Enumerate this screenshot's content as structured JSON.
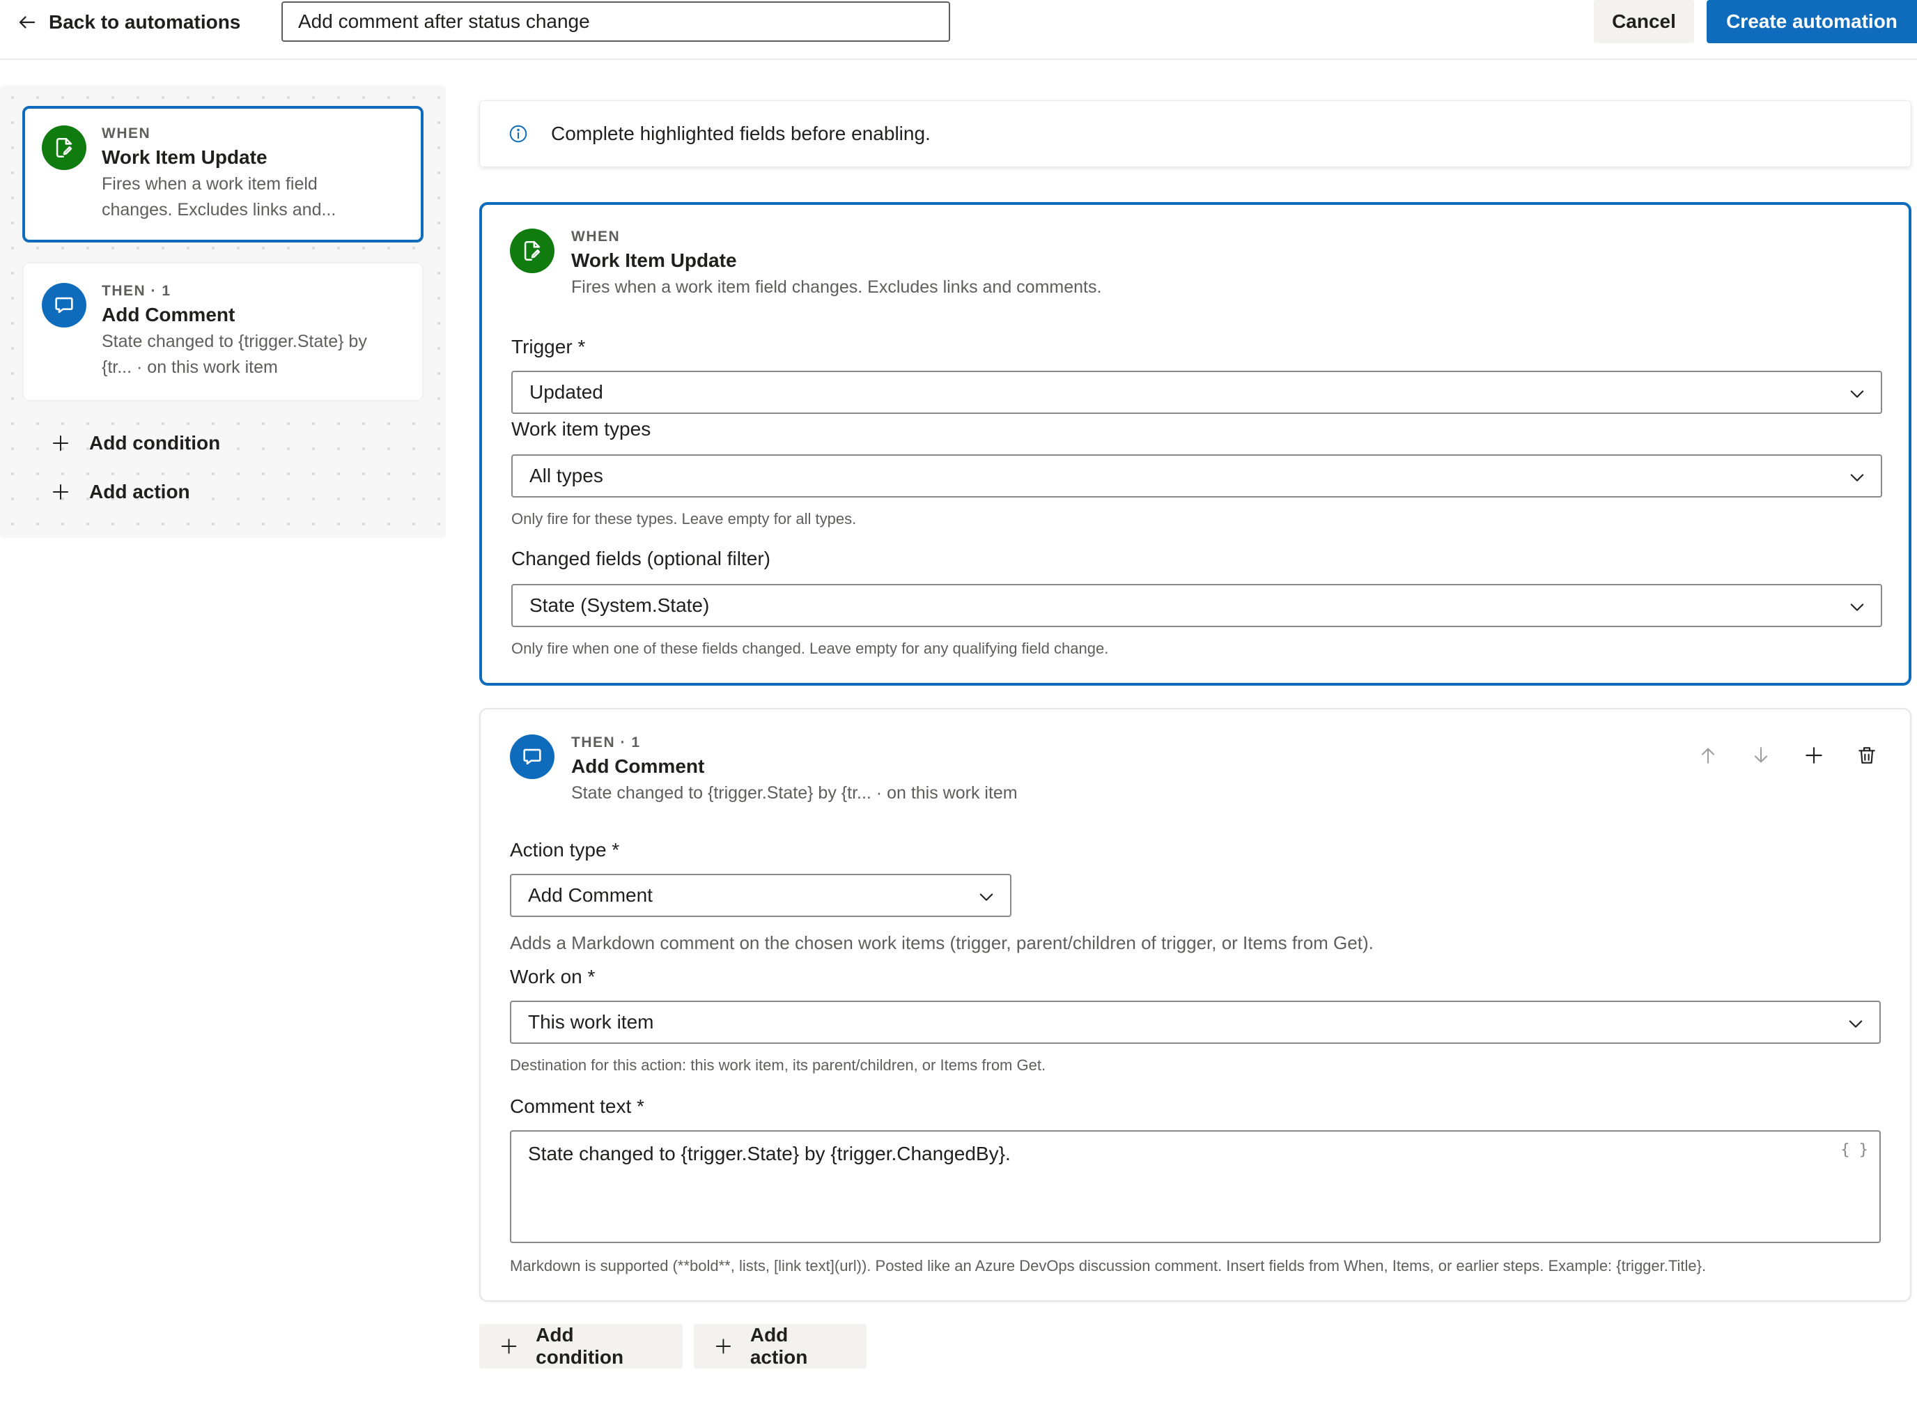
{
  "header": {
    "back_label": "Back to automations",
    "automation_name": "Add comment after status change",
    "cancel_label": "Cancel",
    "create_label": "Create automation"
  },
  "flow": {
    "when_node": {
      "eyebrow": "WHEN",
      "title": "Work Item Update",
      "desc_line1": "Fires when a work item field",
      "desc_line2": "changes. Excludes links and..."
    },
    "then_node": {
      "eyebrow": "THEN · 1",
      "title": "Add Comment",
      "desc_line1": "State changed to {trigger.State} by",
      "desc_line2": "{tr... · on this work item"
    },
    "add_condition": "Add condition",
    "add_action": "Add action"
  },
  "banner": {
    "message": "Complete highlighted fields before enabling."
  },
  "when_card": {
    "eyebrow": "WHEN",
    "title": "Work Item Update",
    "desc": "Fires when a work item field changes. Excludes links and comments.",
    "trigger_label": "Trigger *",
    "trigger_value": "Updated",
    "types_label": "Work item types",
    "types_value": "All types",
    "types_hint": "Only fire for these types. Leave empty for all types.",
    "fields_label": "Changed fields (optional filter)",
    "fields_value": "State (System.State)",
    "fields_hint": "Only fire when one of these fields changed. Leave empty for any qualifying field change."
  },
  "then_card": {
    "eyebrow": "THEN · 1",
    "title": "Add Comment",
    "desc": "State changed to {trigger.State} by {tr... · on this work item",
    "action_type_label": "Action type *",
    "action_type_value": "Add Comment",
    "action_type_hint": "Adds a Markdown comment on the chosen work items (trigger, parent/children of trigger, or Items from Get).",
    "work_on_label": "Work on *",
    "work_on_value": "This work item",
    "work_on_hint": "Destination for this action: this work item, its parent/children, or Items from Get.",
    "comment_label": "Comment text *",
    "comment_value": "State changed to {trigger.State} by {trigger.ChangedBy}.",
    "insert_field_glyph": "{ }",
    "comment_hint": "Markdown is supported (**bold**, lists, [link text](url)). Posted like an Azure DevOps discussion comment. Insert fields from When, Items, or earlier steps. Example: {trigger.Title}."
  },
  "bottom": {
    "add_condition": "Add condition",
    "add_action": "Add action"
  },
  "colors": {
    "accent": "#0f6cbd",
    "trigger_green": "#107c10",
    "button_neutral": "#f3f2f1"
  },
  "icons": {
    "back": "arrow-left-icon",
    "when": "document-edit-icon",
    "then": "comment-icon",
    "info": "info-icon",
    "dropdown": "chevron-down-icon",
    "move_up": "arrow-up-icon",
    "move_down": "arrow-down-icon",
    "add": "plus-icon",
    "delete": "trash-icon"
  }
}
